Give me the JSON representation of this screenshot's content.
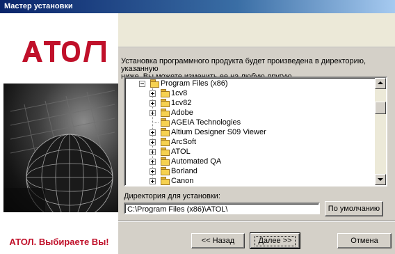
{
  "window": {
    "title": "Мастер установки"
  },
  "brand": {
    "logo_text": "АТОЛ",
    "slogan": "АТОЛ. Выбираете Вы!",
    "color": "#c0102a"
  },
  "description": "Установка программного продукта будет произведена в директорию, указанную\nниже. Вы можете изменить ее на любую другую.",
  "tree": {
    "root": "Program Files (x86)",
    "items": [
      {
        "label": "1cv8",
        "expandable": true
      },
      {
        "label": "1cv82",
        "expandable": true
      },
      {
        "label": "Adobe",
        "expandable": true
      },
      {
        "label": "AGEIA Technologies",
        "expandable": false
      },
      {
        "label": "Altium Designer S09 Viewer",
        "expandable": true
      },
      {
        "label": "ArcSoft",
        "expandable": true
      },
      {
        "label": "ATOL",
        "expandable": true
      },
      {
        "label": "Automated QA",
        "expandable": true
      },
      {
        "label": "Borland",
        "expandable": true
      },
      {
        "label": "Canon",
        "expandable": true
      }
    ]
  },
  "install_dir": {
    "label": "Директория для установки:",
    "value": "C:\\Program Files (x86)\\ATOL\\"
  },
  "buttons": {
    "default_dir": "По умолчанию",
    "back": "<< Назад",
    "next": "Далее >>",
    "cancel": "Отмена"
  },
  "icons": {
    "folder": "folder-icon",
    "expand": "tree-expander-icon",
    "scroll_up": "scroll-up-icon",
    "scroll_down": "scroll-down-icon"
  }
}
